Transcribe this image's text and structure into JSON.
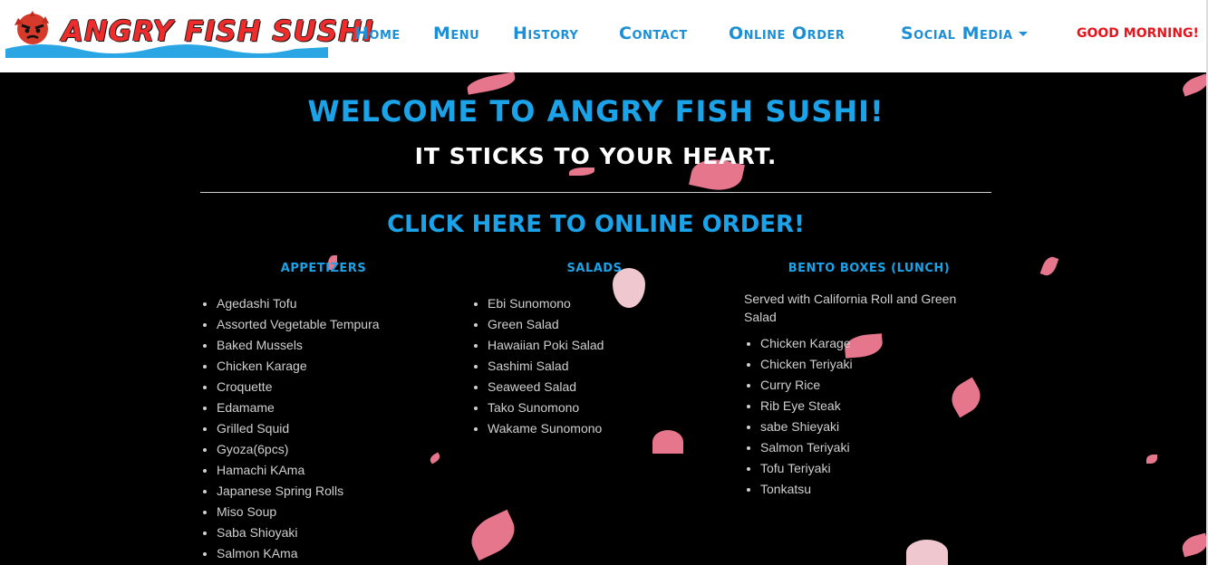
{
  "brand": {
    "name": "ANGRY FISH SUSHI",
    "colors": {
      "accent": "#1aa3e8",
      "nav": "#1d8fd6",
      "brand_red": "#ee2c2c",
      "greeting": "#e8141c"
    }
  },
  "nav": {
    "items": [
      "Home",
      "Menu",
      "History",
      "Contact",
      "Online Order",
      "Social Media"
    ],
    "greeting": "GOOD MORNING!"
  },
  "hero": {
    "welcome": "Welcome to Angry Fish Sushi!",
    "tagline": "It sticks to your heart.",
    "order_link": "Click here to Online Order!"
  },
  "menu": {
    "appetizers": {
      "title": "Appetizers",
      "items": [
        "Agedashi Tofu",
        "Assorted Vegetable Tempura",
        "Baked Mussels",
        "Chicken Karage",
        "Croquette",
        "Edamame",
        "Grilled Squid",
        "Gyoza(6pcs)",
        "Hamachi KAma",
        "Japanese Spring Rolls",
        "Miso Soup",
        "Saba Shioyaki",
        "Salmon KAma"
      ]
    },
    "salads": {
      "title": "Salads",
      "items": [
        "Ebi Sunomono",
        "Green Salad",
        "Hawaiian Poki Salad",
        "Sashimi Salad",
        "Seaweed Salad",
        "Tako Sunomono",
        "Wakame Sunomono"
      ]
    },
    "bento": {
      "title": "Bento Boxes (Lunch)",
      "note": "Served with California Roll and Green Salad",
      "items": [
        "Chicken Karage",
        "Chicken Teriyaki",
        "Curry Rice",
        "Rib Eye Steak",
        "sabe Shieyaki",
        "Salmon Teriyaki",
        "Tofu Teriyaki",
        "Tonkatsu"
      ]
    }
  },
  "icons": {
    "logo": "angry-fish-logo",
    "dropdown": "chevron-down-icon",
    "decor": "cherry-blossom-petal"
  }
}
